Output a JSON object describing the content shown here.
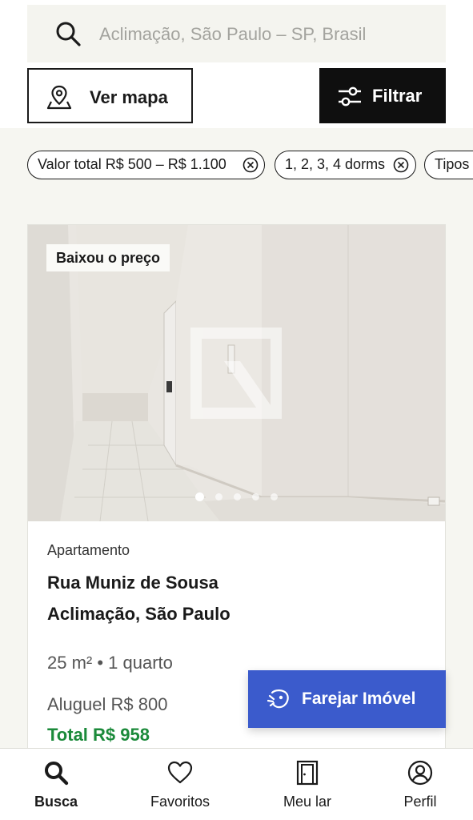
{
  "search": {
    "placeholder": "Aclimação, São Paulo – SP, Brasil",
    "icon": "search-icon"
  },
  "actions": {
    "map_label": "Ver mapa",
    "filter_label": "Filtrar"
  },
  "chips": [
    {
      "label": "Valor total R$ 500 – R$ 1.100"
    },
    {
      "label": "1, 2, 3, 4 dorms"
    },
    {
      "label": "Tipos"
    }
  ],
  "listing": {
    "badge": "Baixou o preço",
    "photo_count": 5,
    "active_photo": 1,
    "type": "Apartamento",
    "street": "Rua Muniz de Sousa",
    "neighborhood": "Aclimação, São Paulo",
    "specs": "25 m² • 1 quarto",
    "rent": "Aluguel R$ 800",
    "total": "Total R$ 958"
  },
  "fab": {
    "label": "Farejar Imóvel"
  },
  "nav": [
    {
      "label": "Busca",
      "icon": "search-icon",
      "active": true
    },
    {
      "label": "Favoritos",
      "icon": "heart-icon",
      "active": false
    },
    {
      "label": "Meu lar",
      "icon": "door-icon",
      "active": false
    },
    {
      "label": "Perfil",
      "icon": "user-circle-icon",
      "active": false
    }
  ],
  "colors": {
    "accent_blue": "#3b5bcc",
    "total_green": "#1b8a3a",
    "filter_black": "#0f0f0f",
    "background": "#f6f6f1"
  }
}
